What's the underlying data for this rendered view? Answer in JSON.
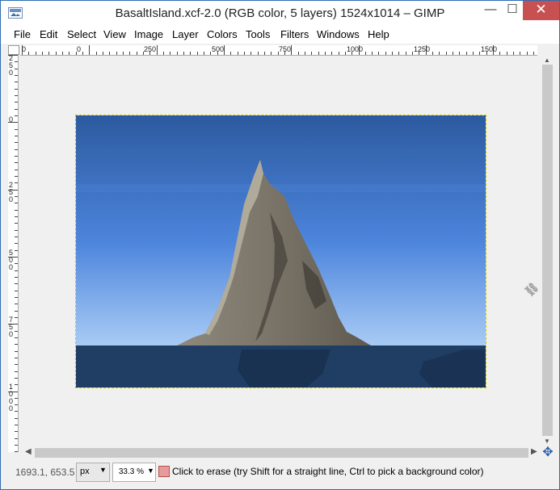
{
  "window": {
    "title": "BasaltIsland.xcf-2.0 (RGB color, 5 layers) 1524x1014 – GIMP",
    "controls": {
      "minimize": "—",
      "maximize": "☐",
      "close": "✕"
    }
  },
  "menu": [
    "File",
    "Edit",
    "Select",
    "View",
    "Image",
    "Layer",
    "Colors",
    "Tools",
    "Filters",
    "Windows",
    "Help"
  ],
  "rulers": {
    "horizontal_labels": [
      "0",
      "0",
      "250",
      "500",
      "750",
      "1000",
      "1250",
      "1500"
    ],
    "vertical_labels": [
      "250",
      "0",
      "250",
      "500",
      "750",
      "1000"
    ]
  },
  "canvas": {
    "image_alt": "Basalt island painting",
    "colors": {
      "sky_top": "#2c5aa0",
      "sky_bottom": "#a8cbf5",
      "sea": "#203d63",
      "rock": "#7a7468",
      "rock_light": "#b9b3a3",
      "selection_border": "#c9c900"
    }
  },
  "statusbar": {
    "coordinates": "1693.1, 653.5",
    "unit": "px",
    "zoom": "33.3 %",
    "message": "Click to erase (try Shift for a straight line, Ctrl to pick a background color)"
  },
  "icons": {
    "app": "gimp-window-icon",
    "navigate": "navigate-icon",
    "chain": "chain-icon",
    "tool": "eraser-tool-icon"
  }
}
